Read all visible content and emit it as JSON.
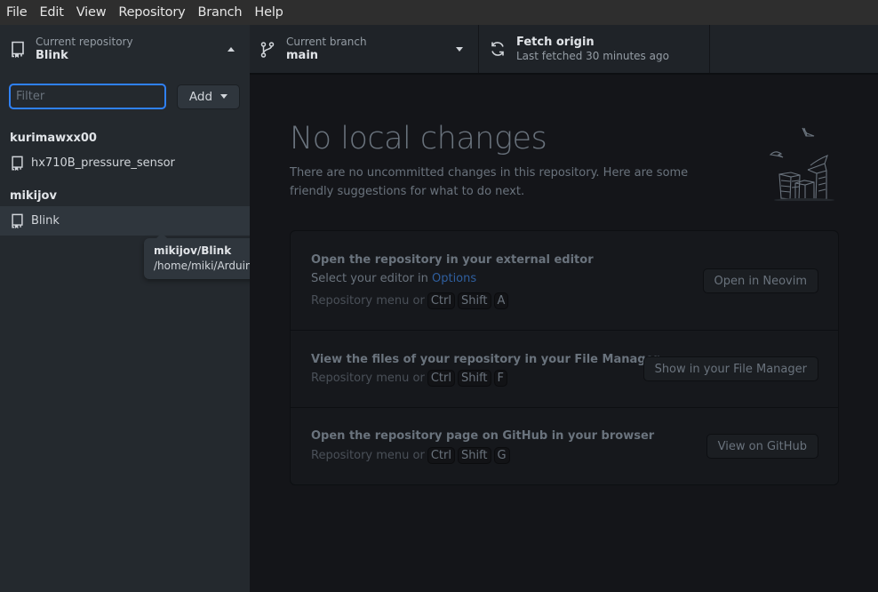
{
  "menu": [
    "File",
    "Edit",
    "View",
    "Repository",
    "Branch",
    "Help"
  ],
  "repo_toolbar": {
    "label": "Current repository",
    "value": "Blink",
    "icon": "repo-icon",
    "toggle_icon": "caret-up-icon"
  },
  "branch_toolbar": {
    "label": "Current branch",
    "value": "main",
    "icon": "git-branch-icon",
    "toggle_icon": "caret-down-icon"
  },
  "fetch_toolbar": {
    "title": "Fetch origin",
    "subtitle": "Last fetched 30 minutes ago",
    "icon": "sync-icon"
  },
  "sidebar": {
    "filter": {
      "value": "",
      "placeholder": "Filter"
    },
    "add_button": "Add",
    "groups": [
      {
        "owner": "kurimawxx00",
        "repos": [
          {
            "name": "hx710B_pressure_sensor",
            "selected": false
          }
        ]
      },
      {
        "owner": "mikijov",
        "repos": [
          {
            "name": "Blink",
            "selected": true
          }
        ]
      }
    ],
    "tooltip": {
      "title": "mikijov/Blink",
      "path": "/home/miki/Arduino/Blink"
    }
  },
  "main": {
    "title": "No local changes",
    "description": "There are no uncommitted changes in this repository. Here are some friendly suggestions for what to do next.",
    "illustration": "empty-papers-illustration",
    "suggestions": [
      {
        "title": "Open the repository in your external editor",
        "subtitle_prefix": "Select your editor in ",
        "subtitle_link": "Options",
        "keys_prefix": "Repository menu or",
        "keys": [
          "Ctrl",
          "Shift",
          "A"
        ],
        "button": "Open in Neovim"
      },
      {
        "title": "View the files of your repository in your File Manager",
        "keys_prefix": "Repository menu or",
        "keys": [
          "Ctrl",
          "Shift",
          "F"
        ],
        "button": "Show in your File Manager"
      },
      {
        "title": "Open the repository page on GitHub in your browser",
        "keys_prefix": "Repository menu or",
        "keys": [
          "Ctrl",
          "Shift",
          "G"
        ],
        "button": "View on GitHub"
      }
    ]
  },
  "colors": {
    "accent": "#2f81f7",
    "link": "#2f5f9f",
    "sidebar_bg": "#24292e",
    "main_bg": "#141519"
  }
}
